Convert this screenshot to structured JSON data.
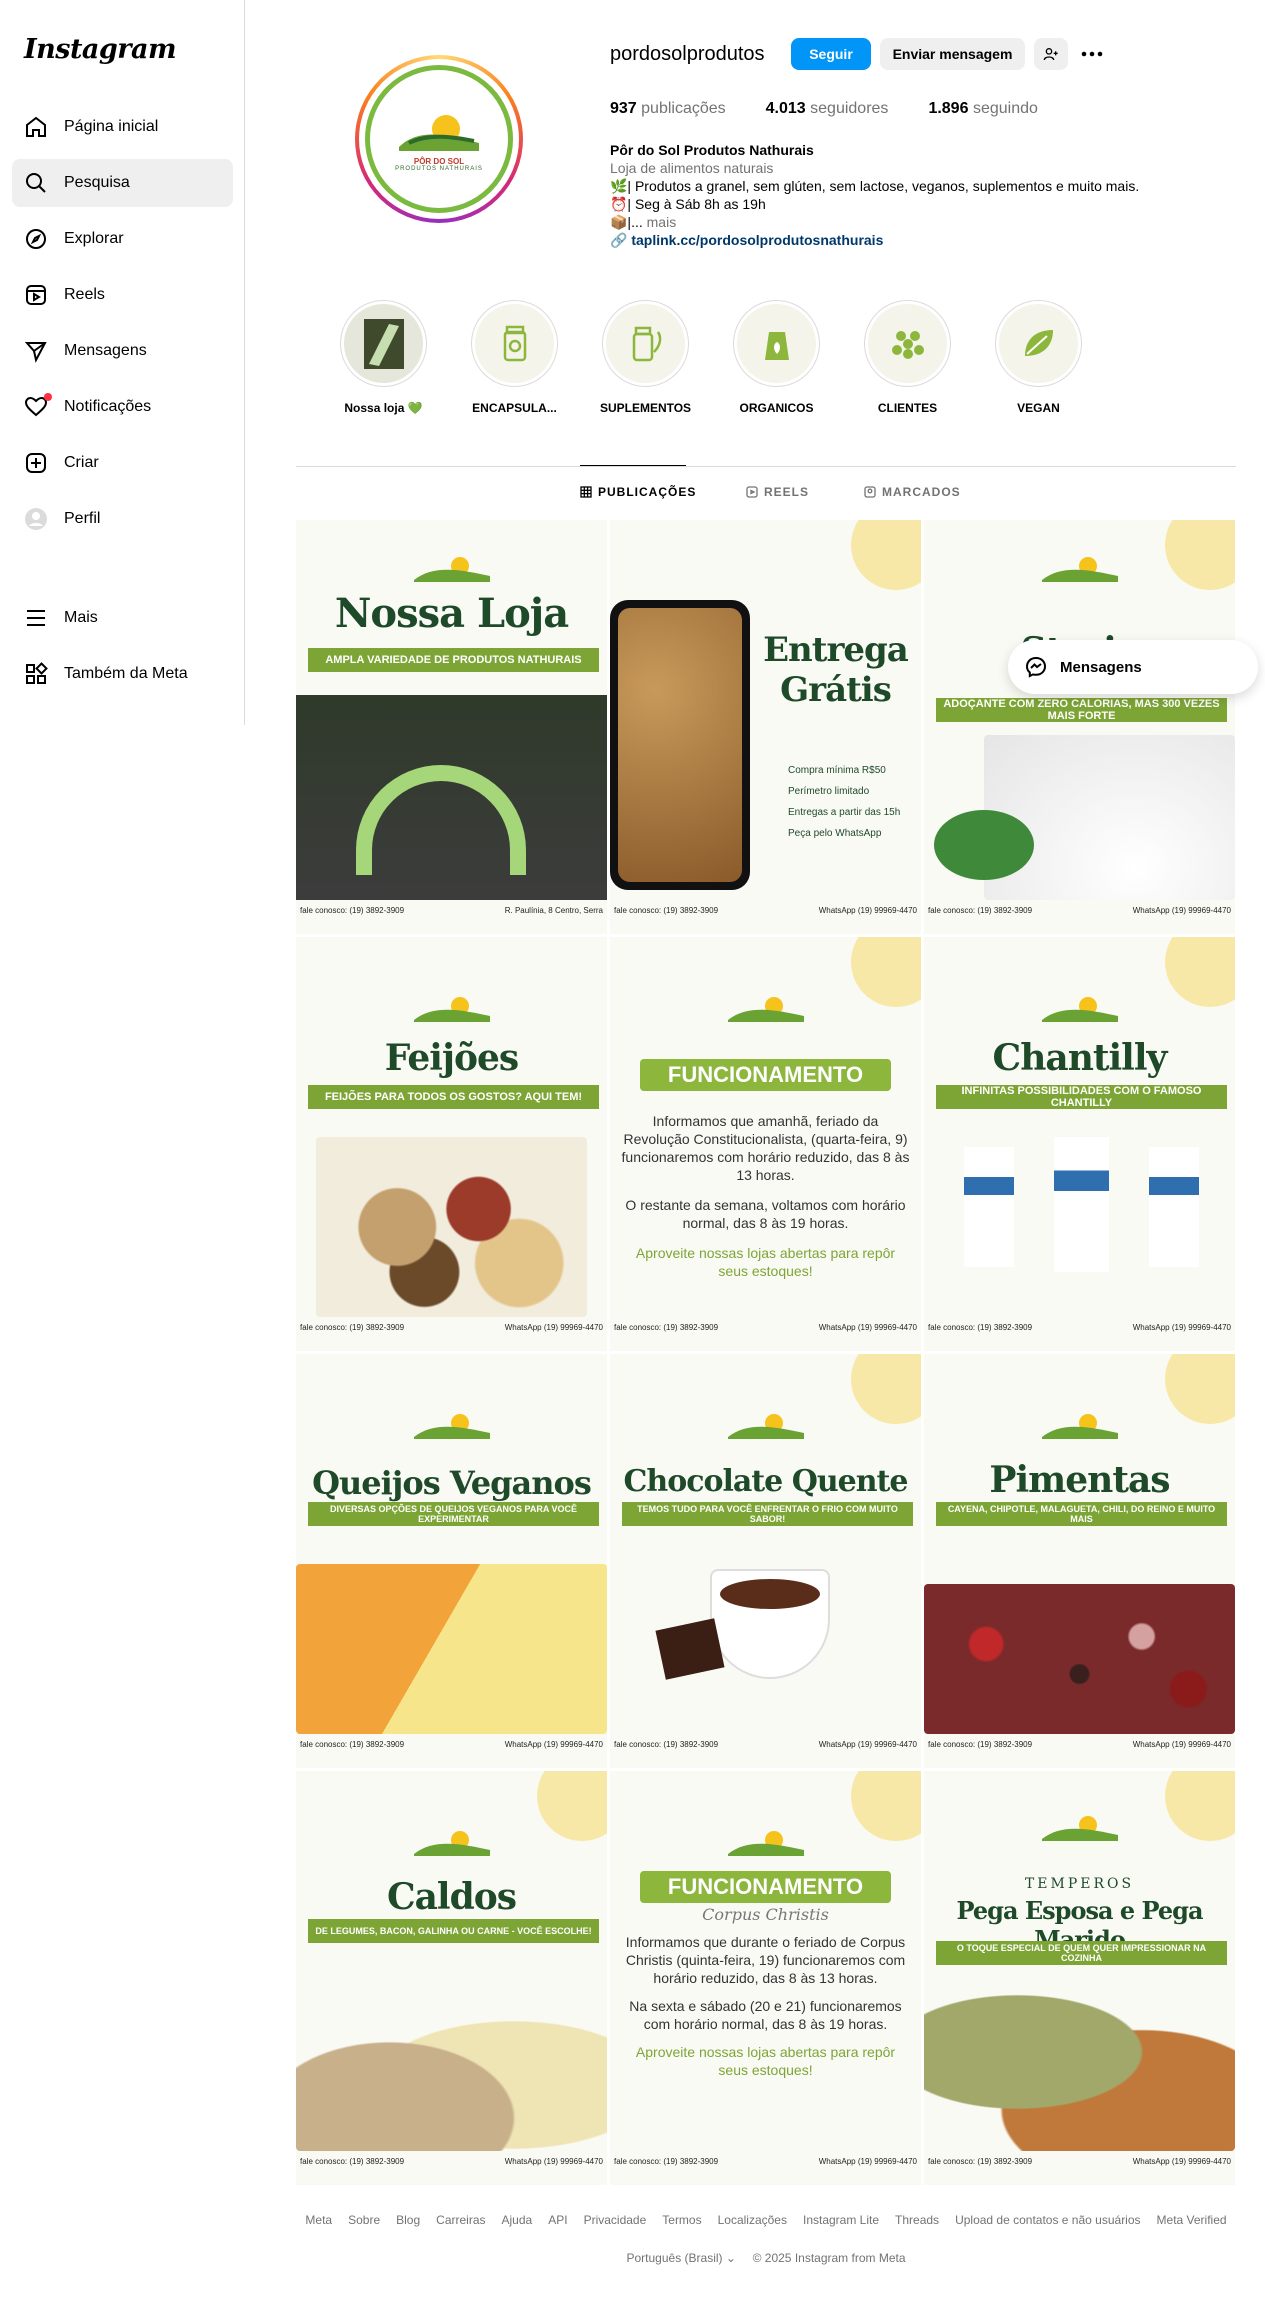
{
  "app": {
    "logo": "Instagram"
  },
  "sidebar": {
    "items": [
      {
        "label": "Página inicial",
        "icon": "home-icon"
      },
      {
        "label": "Pesquisa",
        "icon": "search-icon"
      },
      {
        "label": "Explorar",
        "icon": "compass-icon"
      },
      {
        "label": "Reels",
        "icon": "reels-icon"
      },
      {
        "label": "Mensagens",
        "icon": "send-icon"
      },
      {
        "label": "Notificações",
        "icon": "heart-icon"
      },
      {
        "label": "Criar",
        "icon": "plus-icon"
      },
      {
        "label": "Perfil",
        "icon": "profile-icon"
      }
    ],
    "bottom": [
      {
        "label": "Mais",
        "icon": "menu-icon"
      },
      {
        "label": "Também da Meta",
        "icon": "meta-icon"
      }
    ]
  },
  "profile": {
    "username": "pordosolprodutos",
    "follow_label": "Seguir",
    "message_label": "Enviar mensagem",
    "posts": "937",
    "posts_label": "publicações",
    "followers": "4.013",
    "followers_label": "seguidores",
    "following": "1.896",
    "following_label": "seguindo",
    "name": "Pôr do Sol Produtos Nathurais",
    "category": "Loja de alimentos naturais",
    "bio_line1": "🌿| Produtos a granel, sem glúten, sem lactose, veganos, suplementos e muito mais.",
    "bio_line2": "⏰| Seg à Sáb 8h as 19h",
    "bio_line3": "📦|...",
    "bio_more": "mais",
    "link": "taplink.cc/pordosolprodutosnathurais",
    "logo_text": "PÔR DO SOL",
    "logo_sub": "PRODUTOS NATHURAIS"
  },
  "highlights": [
    {
      "label": "Nossa loja 💚"
    },
    {
      "label": "ENCAPSULA..."
    },
    {
      "label": "SUPLEMENTOS"
    },
    {
      "label": "ORGANICOS"
    },
    {
      "label": "CLIENTES"
    },
    {
      "label": "VEGAN"
    }
  ],
  "tabs": [
    {
      "label": "PUBLICAÇÕES"
    },
    {
      "label": "REELS"
    },
    {
      "label": "MARCADOS"
    }
  ],
  "posts": [
    {
      "title": "Nossa Loja",
      "banner": "AMPLA VARIEDADE DE PRODUTOS NATHURAIS",
      "foot_left": "fale conosco: (19) 3892-3909",
      "foot_right": "R. Paulínia, 8 Centro, Serra"
    },
    {
      "title": "Entrega Grátis",
      "banner": "",
      "foot_left": "fale conosco: (19) 3892-3909",
      "foot_right": "WhatsApp (19) 99969-4470"
    },
    {
      "title": "Stevia",
      "banner": "ADOÇANTE COM ZERO CALORIAS, MAS 300 VEZES MAIS FORTE",
      "foot_left": "fale conosco: (19) 3892-3909",
      "foot_right": "WhatsApp (19) 99969-4470"
    },
    {
      "title": "Feijões",
      "banner": "FEIJÕES PARA TODOS OS GOSTOS? AQUI TEM!",
      "foot_left": "fale conosco: (19) 3892-3909",
      "foot_right": "WhatsApp (19) 99969-4470"
    },
    {
      "title": "",
      "banner": "FUNCIONAMENTO",
      "foot_left": "fale conosco: (19) 3892-3909",
      "foot_right": "WhatsApp (19) 99969-4470"
    },
    {
      "title": "Chantilly",
      "banner": "INFINITAS POSSIBILIDADES COM O FAMOSO CHANTILLY",
      "foot_left": "fale conosco: (19) 3892-3909",
      "foot_right": "WhatsApp (19) 99969-4470"
    },
    {
      "title": "Queijos Veganos",
      "banner": "DIVERSAS OPÇÕES DE QUEIJOS VEGANOS PARA VOCÊ EXPERIMENTAR",
      "foot_left": "fale conosco: (19) 3892-3909",
      "foot_right": "WhatsApp (19) 99969-4470"
    },
    {
      "title": "Chocolate Quente",
      "banner": "TEMOS TUDO PARA VOCÊ ENFRENTAR O FRIO COM MUITO SABOR!",
      "foot_left": "fale conosco: (19) 3892-3909",
      "foot_right": "WhatsApp (19) 99969-4470"
    },
    {
      "title": "Pimentas",
      "banner": "CAYENA, CHIPOTLE, MALAGUETA, CHILI, DO REINO E MUITO MAIS",
      "foot_left": "fale conosco: (19) 3892-3909",
      "foot_right": "WhatsApp (19) 99969-4470"
    },
    {
      "title": "Caldos",
      "banner": "DE LEGUMES, BACON, GALINHA OU CARNE - VOCÊ ESCOLHE!",
      "foot_left": "fale conosco: (19) 3892-3909",
      "foot_right": "WhatsApp (19) 99969-4470"
    },
    {
      "title": "",
      "banner": "FUNCIONAMENTO",
      "foot_left": "fale conosco: (19) 3892-3909",
      "foot_right": "WhatsApp (19) 99969-4470"
    },
    {
      "title": "Pega Esposa e Pega Marido",
      "banner": "O TOQUE ESPECIAL DE QUEM QUER IMPRESSIONAR NA COZINHA",
      "foot_left": "fale conosco: (19) 3892-3909",
      "foot_right": "WhatsApp (19) 99969-4470"
    }
  ],
  "post_texts": {
    "entrega_items": [
      "Compra mínima R$50",
      "Perímetro limitado",
      "Entregas a partir das 15h",
      "Peça pelo WhatsApp"
    ],
    "func1": "Informamos que amanhã, feriado da Revolução Constitucionalista, (quarta-feira, 9) funcionaremos com horário reduzido, das 8 às 13 horas.",
    "func1b": "O restante da semana, voltamos com horário normal, das 8 às 19 horas.",
    "func1c": "Aproveite nossas lojas abertas para repôr seus estoques!",
    "func2_sub": "Corpus Christis",
    "func2": "Informamos que durante o feriado de Corpus Christis (quinta-feira, 19) funcionaremos com horário reduzido, das 8 às 13 horas.",
    "func2b": "Na sexta e sábado (20 e 21) funcionaremos com horário normal, das 8 às 19 horas.",
    "func2c": "Aproveite nossas lojas abertas para repôr seus estoques!",
    "temperos": "TEMPEROS"
  },
  "float_messages": "Mensagens",
  "footer": {
    "links": [
      "Meta",
      "Sobre",
      "Blog",
      "Carreiras",
      "Ajuda",
      "API",
      "Privacidade",
      "Termos",
      "Localizações",
      "Instagram Lite",
      "Threads",
      "Upload de contatos e não usuários",
      "Meta Verified"
    ],
    "language": "Português (Brasil)",
    "copyright": "© 2025 Instagram from Meta"
  }
}
